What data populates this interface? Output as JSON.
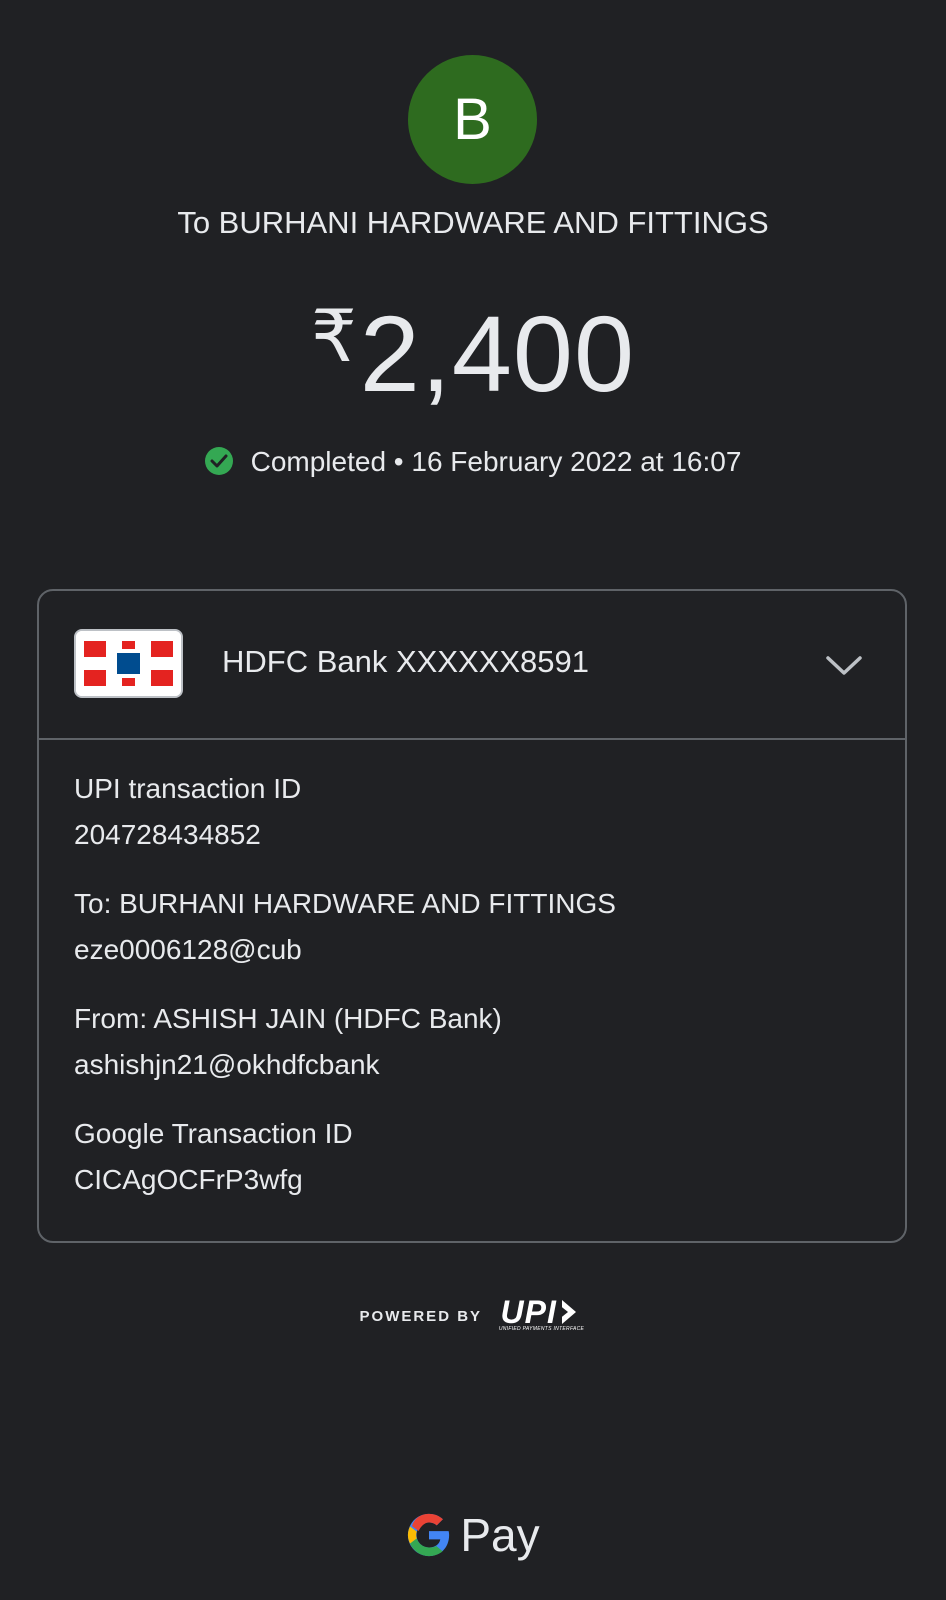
{
  "payee": {
    "avatar_letter": "B",
    "avatar_color": "#2e6b1f",
    "title": "To BURHANI HARDWARE AND FITTINGS"
  },
  "payment": {
    "currency_symbol": "₹",
    "amount": "2,400",
    "status_icon": "check-circle-icon",
    "status_color": "#34a853",
    "status_text": "Completed • 16 February 2022 at 16:07"
  },
  "account": {
    "bank_logo": "hdfc-bank-logo",
    "bank_label": "HDFC Bank XXXXXX8591",
    "expand_icon": "chevron-down-icon"
  },
  "details": [
    {
      "label": "UPI transaction ID",
      "value": "204728434852"
    },
    {
      "label": "To: BURHANI HARDWARE AND FITTINGS",
      "value": "eze0006128@cub"
    },
    {
      "label": "From: ASHISH JAIN (HDFC Bank)",
      "value": "ashishjn21@okhdfcbank"
    },
    {
      "label": "Google Transaction ID",
      "value": "CICAgOCFrP3wfg"
    }
  ],
  "footer": {
    "powered_by": "POWERED BY",
    "upi_logo_text": "UPI",
    "upi_logo_subtext": "UNIFIED PAYMENTS INTERFACE",
    "brand": "Pay"
  }
}
